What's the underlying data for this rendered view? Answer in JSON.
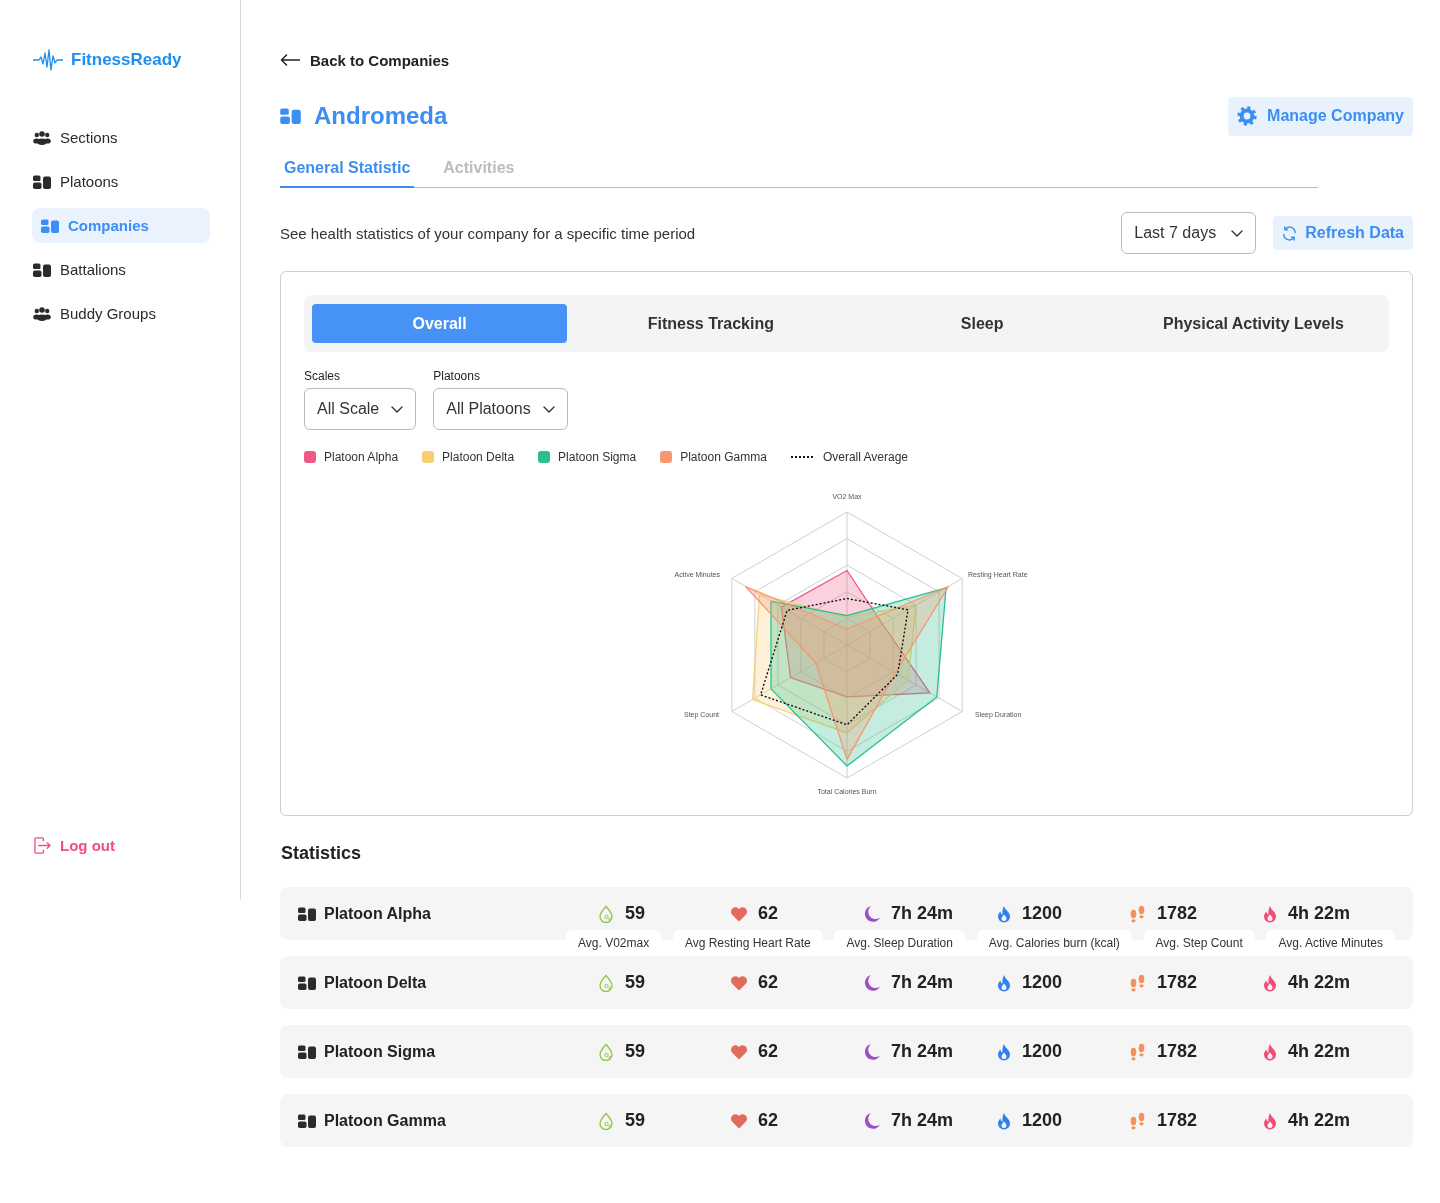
{
  "sidebar": {
    "logo": "FitnessReady",
    "items": [
      {
        "label": "Sections",
        "kind": "team",
        "selected": false
      },
      {
        "label": "Platoons",
        "kind": "units",
        "selected": false
      },
      {
        "label": "Companies",
        "kind": "units",
        "selected": true
      },
      {
        "label": "Battalions",
        "kind": "units",
        "selected": false
      },
      {
        "label": "Buddy Groups",
        "kind": "team",
        "selected": false
      }
    ],
    "logout": "Log out"
  },
  "header": {
    "back_link": "Back to Companies",
    "title": "Andromeda",
    "manage_button": "Manage Company"
  },
  "tabs": [
    {
      "label": "General Statistic",
      "selected": true
    },
    {
      "label": "Activities",
      "selected": false
    }
  ],
  "toolbar": {
    "description": "See health statistics of your company for a specific time period",
    "period": {
      "value": "Last 7 days"
    },
    "refresh_button": "Refresh Data"
  },
  "chart_card": {
    "tabs": [
      {
        "label": "Overall",
        "selected": true
      },
      {
        "label": "Fitness Tracking",
        "selected": false
      },
      {
        "label": "Sleep",
        "selected": false
      },
      {
        "label": "Physical Activity Levels",
        "selected": false
      }
    ],
    "filters": [
      {
        "label": "Scales",
        "value": "All Scale"
      },
      {
        "label": "Platoons",
        "value": "All Platoons"
      }
    ],
    "legend": [
      {
        "label": "Platoon Alpha",
        "kind": "swatch",
        "color": "#ee5b82"
      },
      {
        "label": "Platoon Delta",
        "kind": "swatch",
        "color": "#f7cf72"
      },
      {
        "label": "Platoon Sigma",
        "kind": "swatch",
        "color": "#2bbf8e"
      },
      {
        "label": "Platoon Gamma",
        "kind": "swatch",
        "color": "#f8966e"
      },
      {
        "label": "Overall Average",
        "kind": "dotted-line"
      }
    ],
    "radar": {
      "axes": [
        "VO2 Max",
        "Resting Heart Rate",
        "Sleep Duration",
        "Total Calories Burn",
        "Step Count",
        "Active Minutes"
      ]
    }
  },
  "statistics": {
    "title": "Statistics",
    "metrics": [
      {
        "kind": "vo2",
        "label": "Avg. V02max"
      },
      {
        "kind": "heart",
        "label": "Avg Resting Heart Rate"
      },
      {
        "kind": "sleep",
        "label": "Avg. Sleep Duration"
      },
      {
        "kind": "calories",
        "label": "Avg. Calories burn (kcal)"
      },
      {
        "kind": "steps",
        "label": "Avg. Step Count"
      },
      {
        "kind": "active",
        "label": "Avg. Active Minutes"
      }
    ],
    "rows": [
      {
        "name": "Platoon Alpha",
        "values": [
          "59",
          "62",
          "7h 24m",
          "1200",
          "1782",
          "4h 22m"
        ],
        "show_labels": true
      },
      {
        "name": "Platoon Delta",
        "values": [
          "59",
          "62",
          "7h 24m",
          "1200",
          "1782",
          "4h 22m"
        ],
        "show_labels": false
      },
      {
        "name": "Platoon Sigma",
        "values": [
          "59",
          "62",
          "7h 24m",
          "1200",
          "1782",
          "4h 22m"
        ],
        "show_labels": false
      },
      {
        "name": "Platoon Gamma",
        "values": [
          "59",
          "62",
          "7h 24m",
          "1200",
          "1782",
          "4h 22m"
        ],
        "show_labels": false
      }
    ]
  }
}
